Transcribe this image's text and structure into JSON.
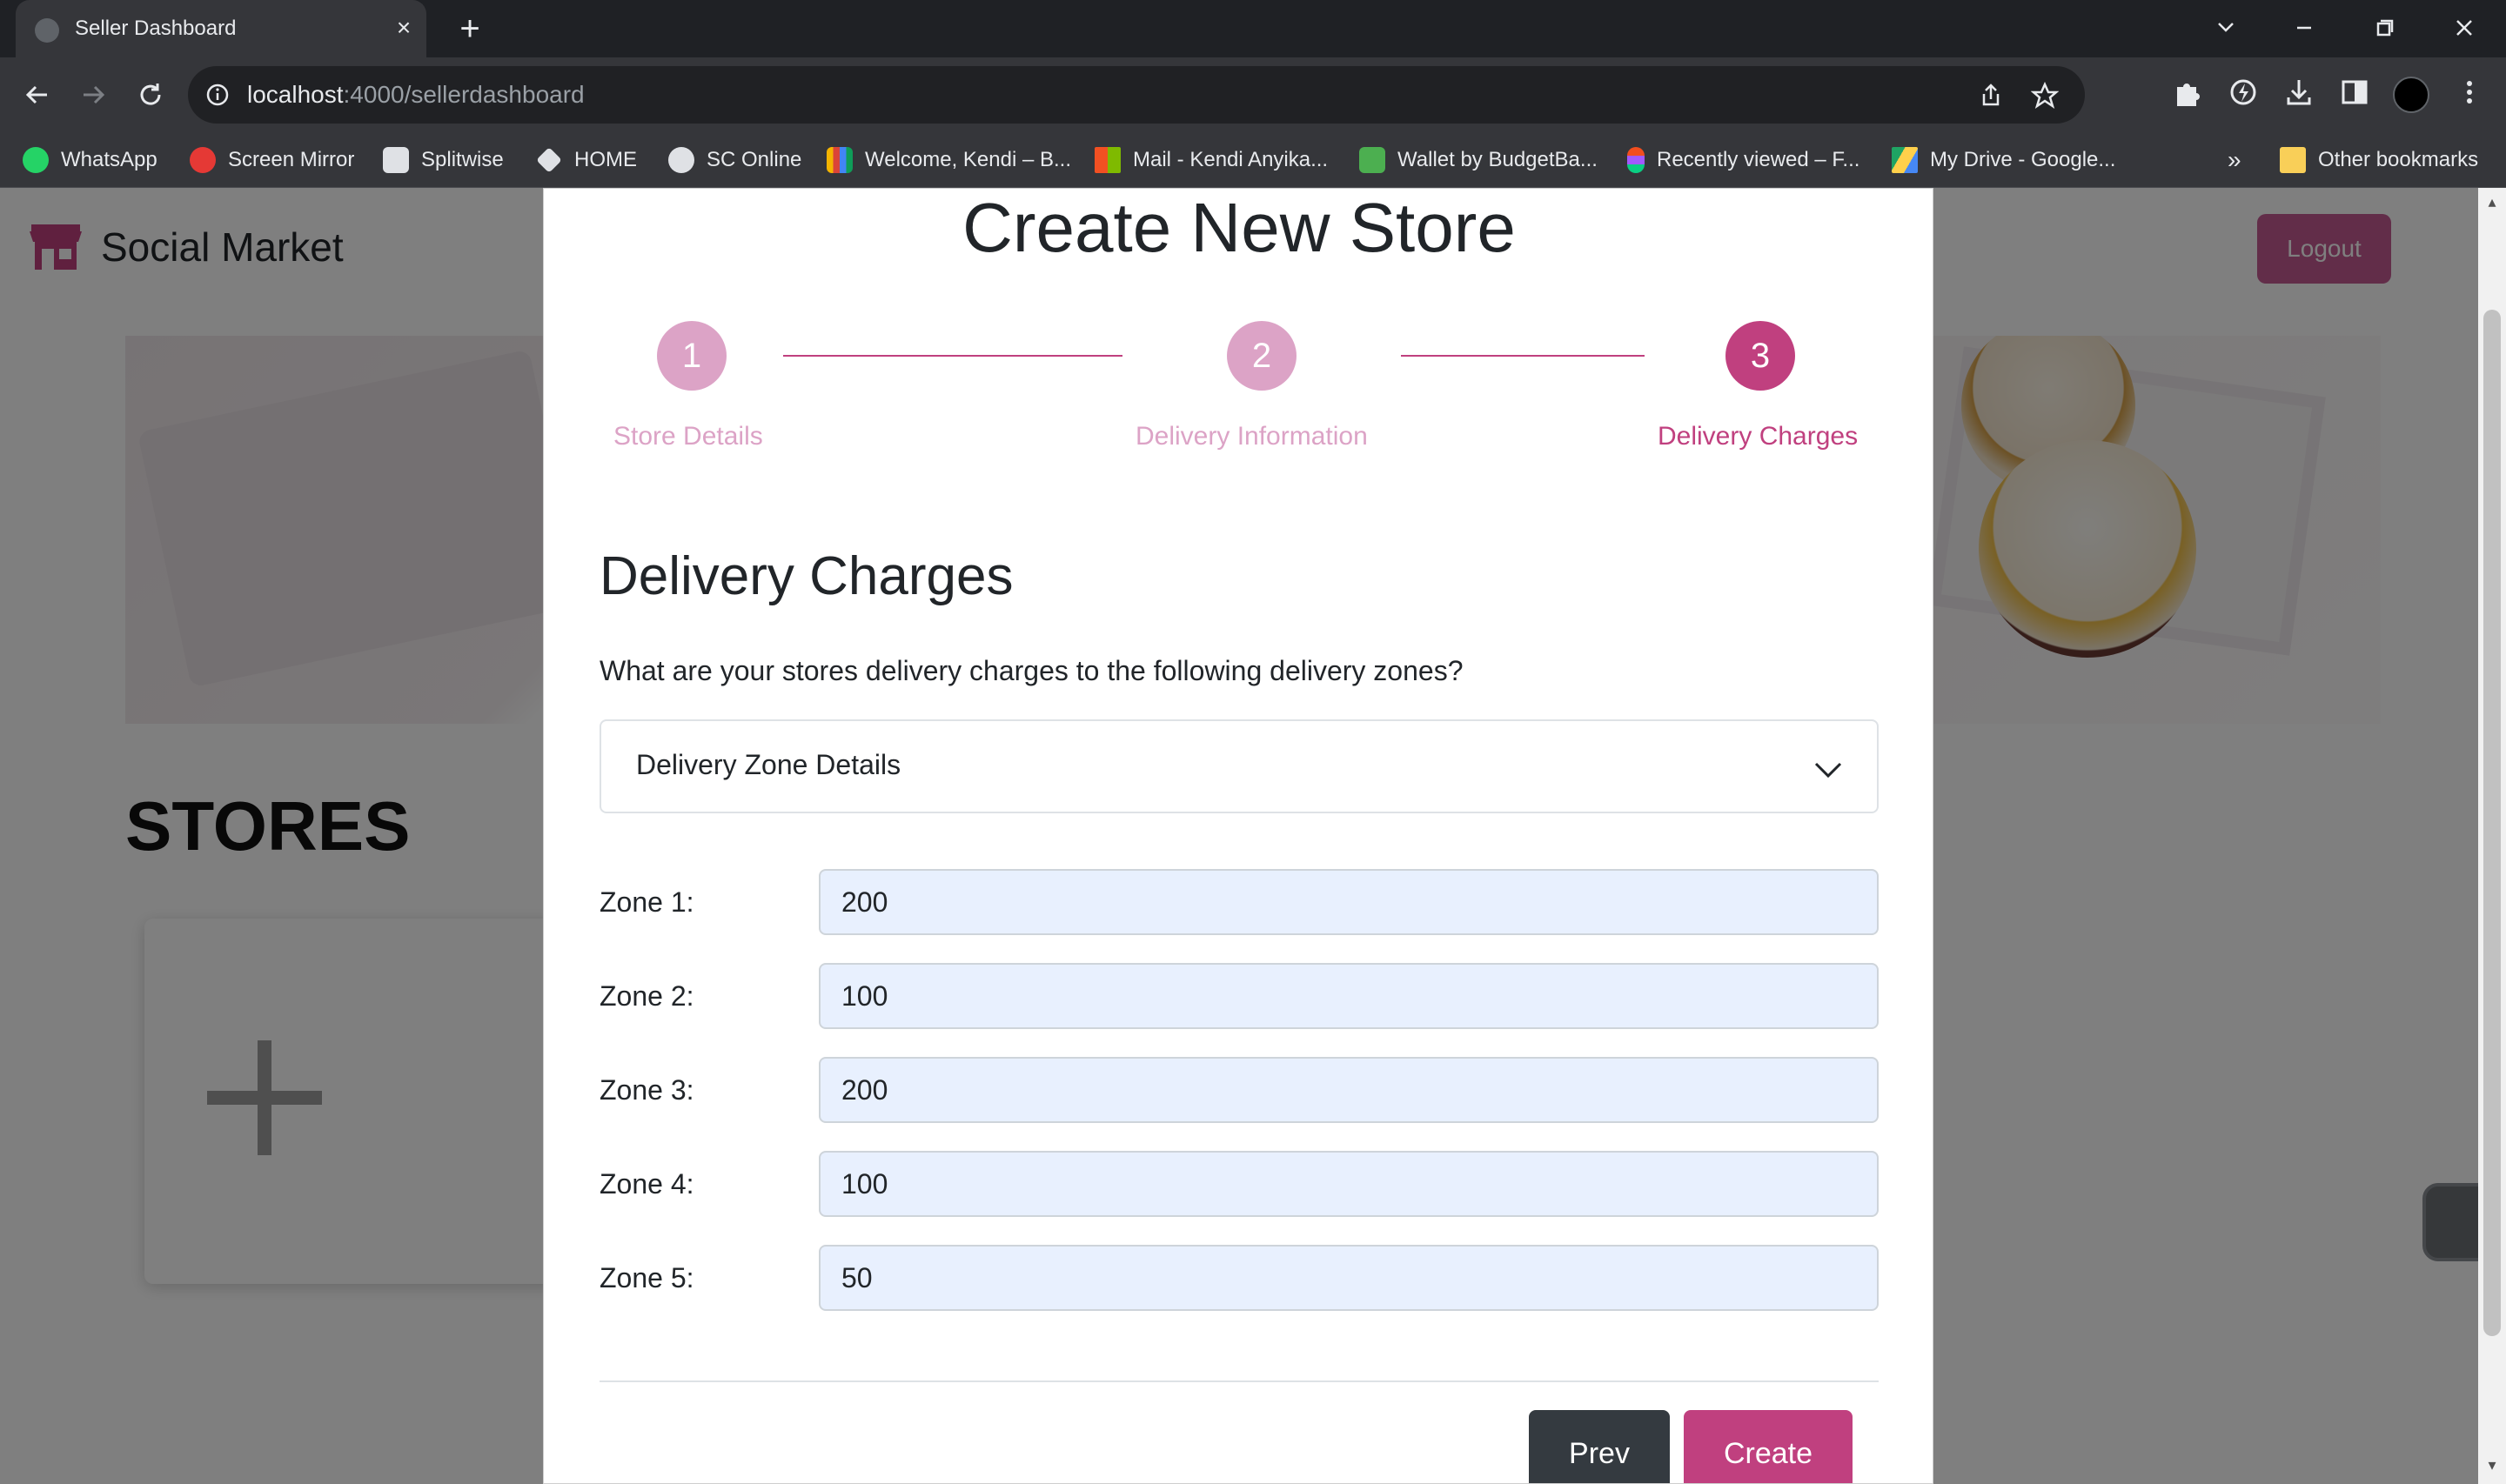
{
  "browser": {
    "tab_title": "Seller Dashboard",
    "url_host": "localhost",
    "url_path": ":4000/sellerdashboard",
    "bookmarks": [
      {
        "label": "WhatsApp",
        "icon": "whatsapp-icon",
        "color": "#25d366"
      },
      {
        "label": "Screen Mirror",
        "icon": "screen-mirror-icon",
        "color": "#e53935"
      },
      {
        "label": "Splitwise",
        "icon": "splitwise-icon",
        "color": "#ffffff"
      },
      {
        "label": "HOME",
        "icon": "home-icon",
        "color": "#ffffff"
      },
      {
        "label": "SC Online",
        "icon": "globe-icon",
        "color": "#ffffff"
      },
      {
        "label": "Welcome, Kendi – B...",
        "icon": "bar-chart-icon",
        "color": "#f4b400"
      },
      {
        "label": "Mail - Kendi Anyika...",
        "icon": "microsoft-icon",
        "color": "#f25022"
      },
      {
        "label": "Wallet by BudgetBa...",
        "icon": "wallet-icon",
        "color": "#4caf50"
      },
      {
        "label": "Recently viewed – F...",
        "icon": "figma-icon",
        "color": "#a259ff"
      },
      {
        "label": "My Drive - Google...",
        "icon": "google-drive-icon",
        "color": "#1fa463"
      }
    ],
    "overflow_label": "»",
    "other_bookmarks": "Other bookmarks"
  },
  "page": {
    "brand": "Social Market",
    "logout": "Logout",
    "stores_title": "STORES",
    "add_symbol": "+"
  },
  "modal": {
    "title": "Create New Store",
    "steps": [
      {
        "number": "1",
        "label": "Store Details",
        "state": "done"
      },
      {
        "number": "2",
        "label": "Delivery Information",
        "state": "done"
      },
      {
        "number": "3",
        "label": "Delivery Charges",
        "state": "active"
      }
    ],
    "section_title": "Delivery Charges",
    "question": "What are your stores delivery charges to the following delivery zones?",
    "accordion_label": "Delivery Zone Details",
    "zones": [
      {
        "label": "Zone 1:",
        "value": "200"
      },
      {
        "label": "Zone 2:",
        "value": "100"
      },
      {
        "label": "Zone 3:",
        "value": "200"
      },
      {
        "label": "Zone 4:",
        "value": "100"
      },
      {
        "label": "Zone 5:",
        "value": "50"
      }
    ],
    "prev_label": "Prev",
    "create_label": "Create"
  },
  "colors": {
    "accent": "#c0407f",
    "step_done": "#dca3c6",
    "input_bg": "#e8f0fe",
    "prev_button": "#343a40"
  }
}
